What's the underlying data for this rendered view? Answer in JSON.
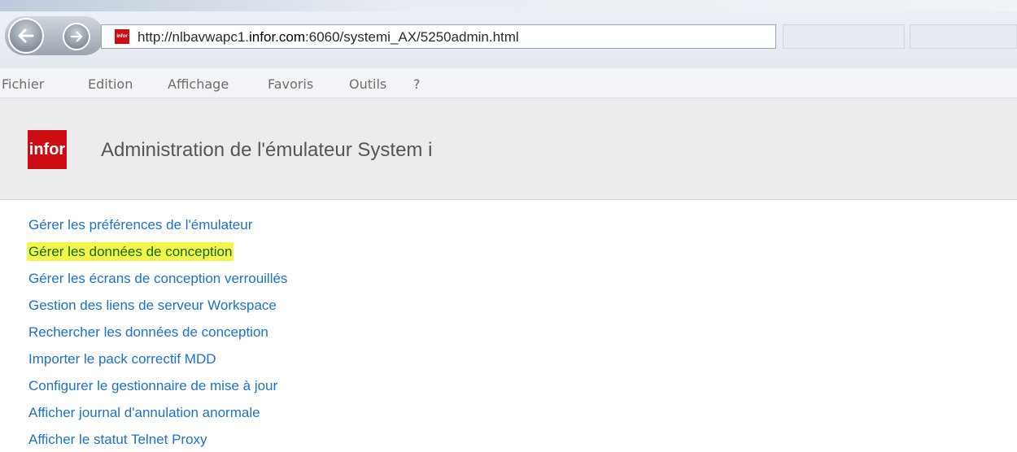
{
  "browser": {
    "url_prefix": "http://nlbavwapc1.",
    "url_domain": "infor.com",
    "url_suffix": ":6060/systemi_AX/5250admin.html",
    "favicon_text": "infor",
    "menu": [
      "Fichier",
      "Edition",
      "Affichage",
      "Favoris",
      "Outils",
      "?"
    ],
    "icons": {
      "back": "back-arrow-icon",
      "forward": "forward-arrow-icon"
    }
  },
  "header": {
    "logo_text": "infor",
    "title": "Administration de l'émulateur System i"
  },
  "links": [
    "Gérer les préférences de l'émulateur",
    "Gérer les données de conception",
    "Gérer les écrans de conception verrouillés",
    "Gestion des liens de serveur Workspace",
    "Rechercher les données de conception",
    "Importer le pack correctif MDD",
    "Configurer le gestionnaire de mise à jour",
    "Afficher journal d'annulation anormale",
    "Afficher le statut Telnet Proxy"
  ],
  "highlighted_link_index": 1,
  "colors": {
    "brand": "#cc0d14",
    "link": "#1a72c9",
    "highlight": "#f3f54a"
  }
}
